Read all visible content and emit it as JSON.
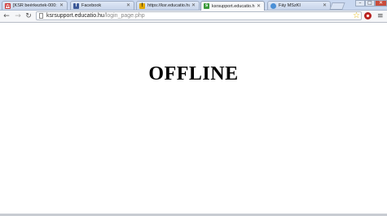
{
  "tabs": [
    {
      "title": "[KSR beérkeztek-000:",
      "favicon": "gmail-icon",
      "active": false
    },
    {
      "title": "Facebook",
      "favicon": "facebook-icon",
      "active": false
    },
    {
      "title": "https://ksr.educatio.hu",
      "favicon": "warning-icon",
      "active": false
    },
    {
      "title": "ksrsupport.educatio.hu",
      "favicon": "support-icon",
      "active": true
    },
    {
      "title": "Fáy MSzKI",
      "favicon": "globe-icon",
      "active": false
    }
  ],
  "toolbar": {
    "url_host": "ksrsupport.educatio.hu",
    "url_path": "/login_page.php"
  },
  "content": {
    "heading": "OFFLINE"
  },
  "colors": {
    "tabstrip": "#c9d8f0",
    "star": "#e2b400",
    "extension": "#d0312d"
  }
}
